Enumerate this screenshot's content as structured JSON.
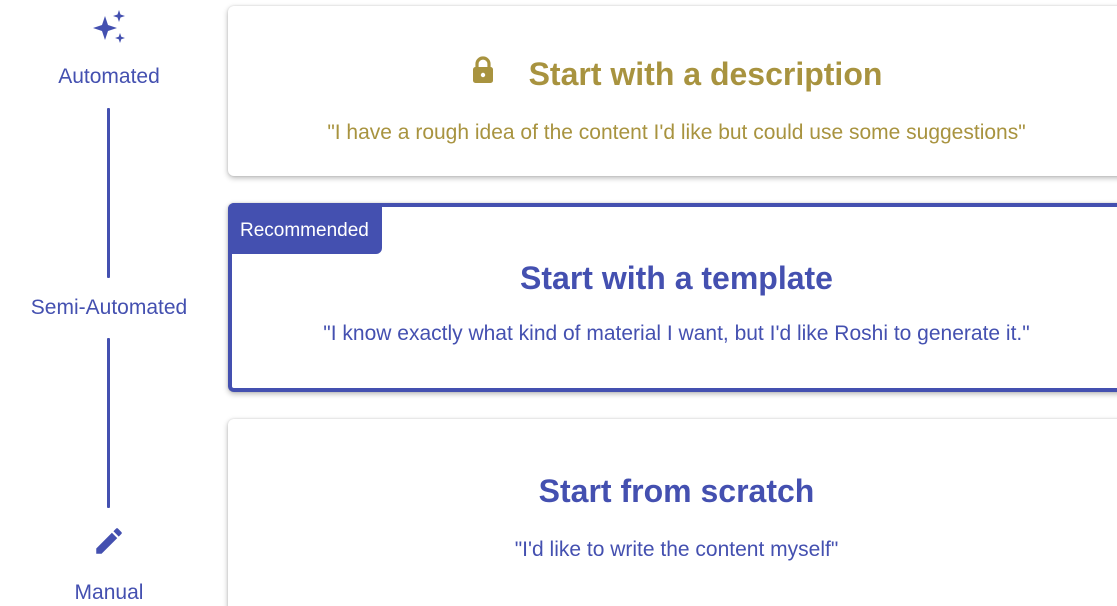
{
  "scale": {
    "top_label": "Automated",
    "middle_label": "Semi-Automated",
    "bottom_label": "Manual",
    "top_icon": "sparkles-icon",
    "bottom_icon": "pencil-icon"
  },
  "cards": {
    "description": {
      "title": "Start with a description",
      "quote": "\"I have a rough idea of the content I'd like but could use some suggestions\"",
      "icon": "lock-icon",
      "locked": true
    },
    "template": {
      "badge": "Recommended",
      "title": "Start with a template",
      "quote": "\"I know exactly what kind of material I want, but I'd like Roshi to generate it.\"",
      "selected": true
    },
    "scratch": {
      "title": "Start from scratch",
      "quote": "\"I'd like to write the content myself\""
    }
  },
  "colors": {
    "primary": "#4450b0",
    "locked": "#a8933f",
    "background": "#ffffff"
  }
}
